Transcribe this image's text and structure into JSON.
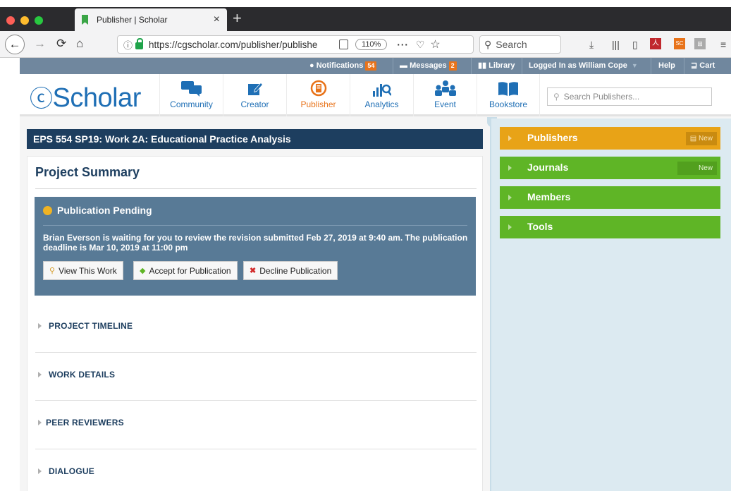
{
  "browser": {
    "tab_title": "Publisher | Scholar",
    "tab_close": "×",
    "new_tab": "+",
    "url": "https://cgscholar.com/publisher/publishe",
    "zoom": "110%",
    "search_placeholder": "Search"
  },
  "topnav": {
    "notifications_label": "Notifications",
    "notifications_count": "54",
    "messages_label": "Messages",
    "messages_count": "2",
    "library_label": "Library",
    "logged_in": "Logged In as William Cope",
    "help": "Help",
    "cart": "Cart"
  },
  "header": {
    "logo": "Scholar",
    "nav": [
      {
        "label": "Community",
        "icon": "community-icon"
      },
      {
        "label": "Creator",
        "icon": "creator-icon"
      },
      {
        "label": "Publisher",
        "icon": "publisher-icon"
      },
      {
        "label": "Analytics",
        "icon": "analytics-icon"
      },
      {
        "label": "Event",
        "icon": "event-icon"
      },
      {
        "label": "Bookstore",
        "icon": "bookstore-icon"
      }
    ],
    "search_placeholder": "Search Publishers..."
  },
  "main": {
    "title": "EPS 554 SP19: Work 2A: Educational Practice Analysis",
    "summary_title": "Project Summary",
    "pending": {
      "title": "Publication Pending",
      "message": "Brian Everson is waiting for you to review the revision submitted Feb 27, 2019 at 9:40 am. The publication deadline is Mar 10, 2019 at 11:00 pm",
      "buttons": {
        "view": "View This Work",
        "accept": "Accept for Publication",
        "decline": "Decline Publication"
      }
    },
    "sections": [
      "PROJECT TIMELINE",
      "WORK DETAILS",
      "PEER REVIEWERS",
      "DIALOGUE"
    ]
  },
  "sidebar": {
    "items": [
      {
        "label": "Publishers",
        "badge": "New",
        "color": "#e8a317"
      },
      {
        "label": "Journals",
        "badge": "New",
        "color": "#5fb526"
      },
      {
        "label": "Members",
        "badge": "",
        "color": "#5fb526"
      },
      {
        "label": "Tools",
        "badge": "",
        "color": "#5fb526"
      }
    ]
  },
  "colors": {
    "brand_blue": "#1f6fb5",
    "title_navy": "#1d3e5f",
    "accent_orange": "#e8731a",
    "pending_panel": "#587a96",
    "sidebar_bg": "#dceaf1"
  }
}
